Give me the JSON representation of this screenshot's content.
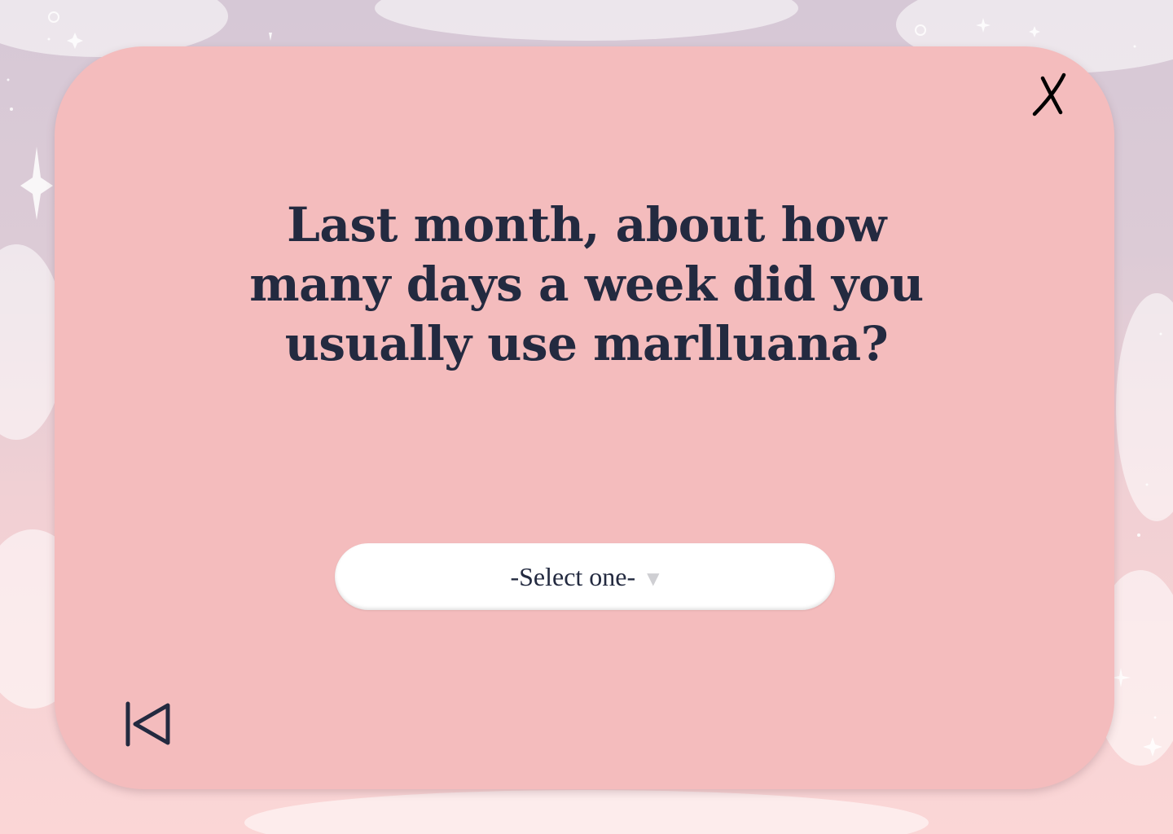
{
  "question": {
    "text": "Last month, about how many days a week did you usually use marlluana?"
  },
  "answer_select": {
    "selected_label": "-Select one-",
    "arrow_glyph": "▼"
  },
  "icons": {
    "close": "close-icon",
    "back": "skip-back-icon"
  },
  "colors": {
    "card_background": "#f4bcbd",
    "text": "#232a40",
    "select_background": "#ffffff"
  }
}
